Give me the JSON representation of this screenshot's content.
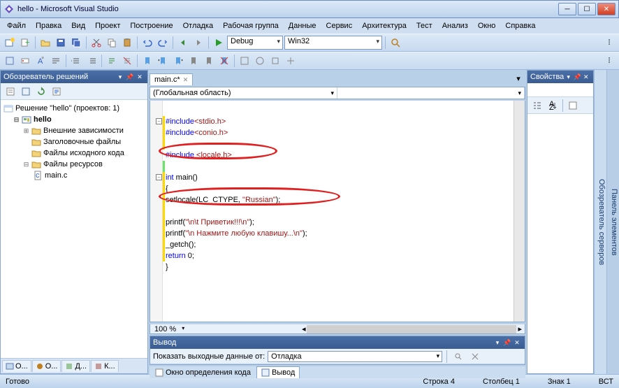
{
  "window": {
    "title": "hello - Microsoft Visual Studio"
  },
  "menu": [
    "Файл",
    "Правка",
    "Вид",
    "Проект",
    "Построение",
    "Отладка",
    "Рабочая группа",
    "Данные",
    "Сервис",
    "Архитектура",
    "Тест",
    "Анализ",
    "Окно",
    "Справка"
  ],
  "toolbar1": {
    "config": "Debug",
    "platform": "Win32"
  },
  "solution_explorer": {
    "title": "Обозреватель решений",
    "root": "Решение \"hello\" (проектов: 1)",
    "project": "hello",
    "folders": [
      "Внешние зависимости",
      "Заголовочные файлы",
      "Файлы исходного кода",
      "Файлы ресурсов"
    ],
    "file": "main.c",
    "bottom_tabs": [
      "О...",
      "О...",
      "Д...",
      "К..."
    ]
  },
  "editor": {
    "tab": "main.c*",
    "scope": "(Глобальная область)",
    "zoom": "100 %",
    "code": {
      "l1_a": "#include",
      "l1_b": "<stdio.h>",
      "l2_a": "#include",
      "l2_b": "<conio.h>",
      "l3_a": "#include ",
      "l3_b": "<locale.h>",
      "l4_a": "int",
      "l4_b": " main()",
      "l5": "{",
      "l6_a": "setlocale(LC_CTYPE, ",
      "l6_b": "\"Russian\"",
      "l6_c": ");",
      "l7_a": "printf(",
      "l7_b": "\"\\n\\t Приветик!!!\\n\"",
      "l7_c": ");",
      "l8_a": "printf(",
      "l8_b": "\"\\n Нажмите любую клавишу...\\n\"",
      "l8_c": ");",
      "l9": "_getch();",
      "l10_a": "return",
      "l10_b": " 0;",
      "l11": "}"
    }
  },
  "output": {
    "title": "Вывод",
    "label": "Показать выходные данные от:",
    "source": "Отладка",
    "tabs": [
      "Окно определения кода",
      "Вывод"
    ]
  },
  "properties": {
    "title": "Свойства"
  },
  "side_strips": {
    "servers": "Обозреватель серверов",
    "toolbox": "Панель элементов"
  },
  "status": {
    "ready": "Готово",
    "line": "Строка 4",
    "col": "Столбец 1",
    "char": "Знак 1",
    "ins": "ВСТ"
  }
}
